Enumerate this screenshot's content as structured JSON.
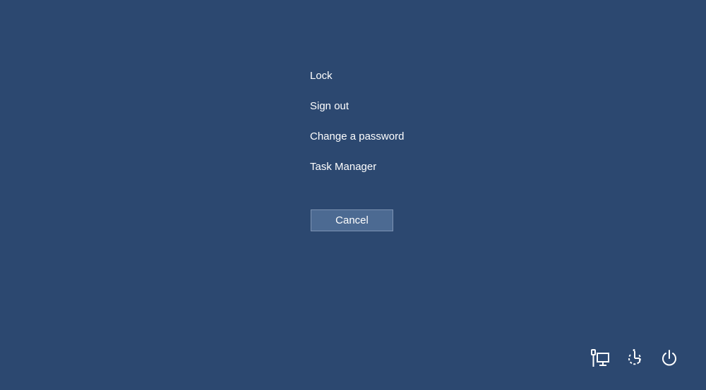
{
  "menu": {
    "items": [
      {
        "label": "Lock"
      },
      {
        "label": "Sign out"
      },
      {
        "label": "Change a password"
      },
      {
        "label": "Task Manager"
      }
    ]
  },
  "cancel_label": "Cancel",
  "tray": {
    "icons": [
      "network-icon",
      "ease-of-access-icon",
      "power-icon"
    ]
  },
  "colors": {
    "background": "#2c4870",
    "button_bg": "#4c6a92",
    "text": "#ffffff"
  }
}
